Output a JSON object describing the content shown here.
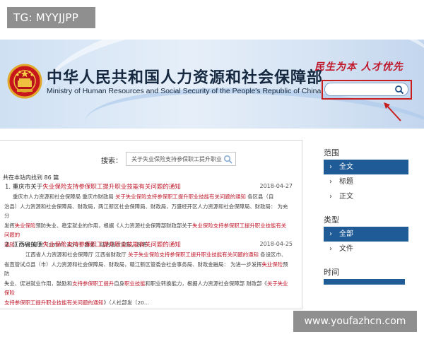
{
  "tag": "TG: MYYJJPP",
  "header": {
    "title_cn": "中华人民共和国人力资源和社会保障部",
    "title_en": "Ministry of Human Resources and Social Security of the People's Republic of China",
    "slogan": "民生为本  人才优先",
    "search_placeholder": "",
    "highlight_color": "#c81e1e"
  },
  "search": {
    "label": "搜索：",
    "query": "关于失业保险支持参保职工提升职业",
    "found_text": "共在本站内找到 86 篇"
  },
  "results": [
    {
      "title_pre": "1. 重庆市关于",
      "title_hl": "失业保险支持参保职工提升职业技能有关问题的通知",
      "date": "2018-04-27",
      "lines": [
        {
          "t": "重庆市人力资源和社会保障局 重庆市财政局 ",
          "h": "关于失业保险支持参保职工提升职业技能有关问题的通知",
          "t2": " 各区县（自"
        },
        {
          "t": "治县）人力资源和社会保障局、财政局，两江新区社会保障局、财政局，万盛经开区人力资源和社会保障局、财政局：   为充分"
        },
        {
          "t": "发挥",
          "h": "失业保险",
          "t2": "预防失业、稳定就业的作用，根据《人力资源社会保障部财政部关于",
          "h2": "失业保险支持参保职工提升职业技能有关问题的"
        },
        {
          "h": "通知",
          "t": "》（人社部发〔2017〕40号）要求，结合我市实际，现将..."
        }
      ]
    },
    {
      "title_pre": "2. 江西省关于",
      "title_hl": "失业保险支持参保职工提升职业技能有关问题的通知",
      "date": "2018-04-25",
      "lines": [
        {
          "t": "江西省人力资源和社会保障厅 江西省财政厅 ",
          "h": "关于失业保险支持参保职工提升职业技能有关问题的通知",
          "t2": " 各设区市、"
        },
        {
          "t": "省直管试点县（市）人力资源和社会保障局、财政局，赣江新区管委会社会事务局、财政金融局：   为进一步发挥",
          "h": "失业保险",
          "t2": "预防"
        },
        {
          "t": "失业、促进就业作用，鼓励和",
          "h": "支持参保职工提升",
          "t2": "自身",
          "h2": "职业技能",
          "t3": "和职业转换能力，根据人力资源社会保障部 财政部《",
          "h3": "关于失业保险"
        },
        {
          "h": "支持参保职工提升职业技能有关问题的通知",
          "t": "》（人社部发〔20..."
        }
      ]
    }
  ],
  "sidebar": {
    "range_heading": "范围",
    "range_items": [
      "全文",
      "标题",
      "正文"
    ],
    "type_heading": "类型",
    "type_items": [
      "全部",
      "文件"
    ],
    "time_heading": "时间",
    "accent_color": "#1f5b96"
  },
  "watermark": "www.youfazhcn.com"
}
